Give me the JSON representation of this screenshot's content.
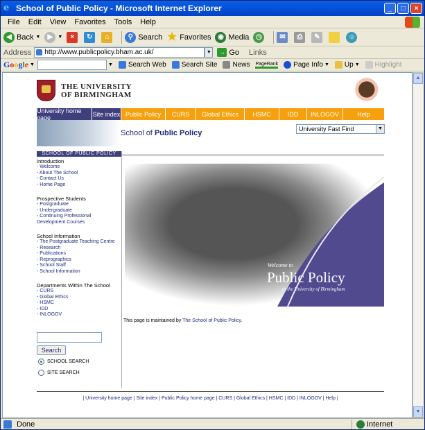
{
  "window": {
    "title": "School of  Public Policy - Microsoft Internet Explorer",
    "controls": [
      "_",
      "□",
      "×"
    ]
  },
  "menu": [
    "File",
    "Edit",
    "View",
    "Favorites",
    "Tools",
    "Help"
  ],
  "toolbar": {
    "back": "Back",
    "search": "Search",
    "favorites": "Favorites",
    "media": "Media"
  },
  "address": {
    "label": "Address",
    "url": "http://www.publicpolicy.bham.ac.uk/",
    "go": "Go",
    "links": "Links"
  },
  "googlebar": {
    "logo": "Google",
    "search_web": "Search Web",
    "search_site": "Search Site",
    "news": "News",
    "pagerank": "PageRank",
    "page_info": "Page Info",
    "up": "Up",
    "highlight": "Highlight"
  },
  "page": {
    "university_line1": "THE UNIVERSITY",
    "university_line2": "OF BIRMINGHAM",
    "nav": [
      "University home page",
      "Site index",
      "Public Policy",
      "CURS",
      "Global Ethics",
      "HSMC",
      "IDD",
      "INLOGOV",
      "Help"
    ],
    "school_of": "School of",
    "public_policy": "Public Policy",
    "fast_find": "University Fast Find",
    "sidebar": {
      "heading": "SCHOOL OF PUBLIC POLICY",
      "introduction": {
        "title": "Introduction",
        "items": [
          "- Welcome",
          "- About The School",
          "- Contact Us",
          "- Home Page"
        ]
      },
      "prospective": {
        "title": "Prospective Students",
        "items": [
          "- Postgraduate",
          "- Undergraduate",
          "- Continuing Professional",
          "Development Courses"
        ]
      },
      "school_info": {
        "title": "School Information",
        "items": [
          "- The Postgraduate Teaching Centre",
          "- Research",
          "- Publications",
          "- Reprographics",
          "- School Staff",
          "- School Information"
        ]
      },
      "departments": {
        "title": "Departments Within The School",
        "items": [
          "- CURS",
          "- Global Ethics",
          "- HSMC",
          "- IDD",
          "- INLOGOV"
        ]
      },
      "search_button": "Search",
      "school_search": "SCHOOL SEARCH",
      "site_search": "SITE SEARCH"
    },
    "hero": {
      "welcome": "Welcome to",
      "title": "Public Policy",
      "subtitle": "at the University of Birmingham"
    },
    "maintained_prefix": "This page is maintained by",
    "maintained_link": "The School of Public Policy",
    "maintained_suffix": ".",
    "footer": "| University home page | Site index | Public Policy home page | CURS | Global Ethics | HSMC | IDD | INLOGOV | Help |"
  },
  "status": {
    "text": "Done",
    "zone": "Internet"
  }
}
